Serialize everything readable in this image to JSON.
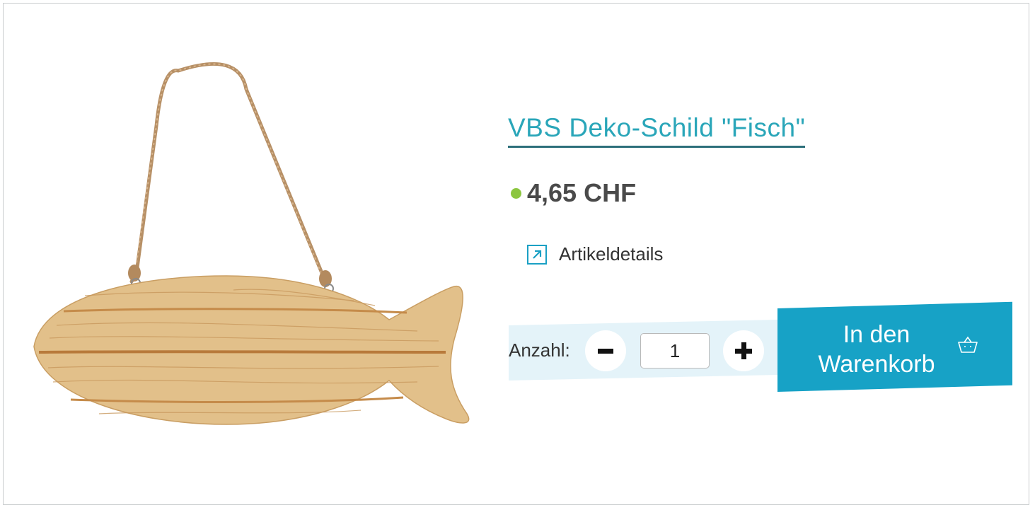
{
  "product": {
    "title": "VBS Deko-Schild \"Fisch\"",
    "price": "4,65 CHF",
    "availability_color": "#8cc63f",
    "details_label": "Artikeldetails"
  },
  "quantity": {
    "label": "Anzahl:",
    "value": "1"
  },
  "cart": {
    "label_line1": "In den",
    "label_line2": "Warenkorb",
    "icon": "basket-icon"
  },
  "colors": {
    "accent": "#17a2c6",
    "title": "#2aa6b9",
    "quantity_bg": "#e4f3f9"
  }
}
